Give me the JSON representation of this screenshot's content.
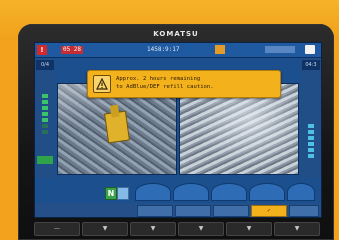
{
  "device": {
    "brand": "KOMATSU"
  },
  "statusbar": {
    "alert_label": "!",
    "mode_label": "05 28",
    "clock": "1458:9:17"
  },
  "left_panel": {
    "label": "0/4"
  },
  "right_panel": {
    "label": "04:3"
  },
  "warning": {
    "icon": "refill-warning-icon",
    "line1": "Approx. 2 hours remaining",
    "line2": "to AdBlue/DEF refill caution."
  },
  "drive": {
    "gear": "N"
  },
  "softkeys": [
    {
      "label": "",
      "active": false
    },
    {
      "label": "",
      "active": false
    },
    {
      "label": "",
      "active": false
    },
    {
      "label": "✓",
      "active": true
    },
    {
      "label": "",
      "active": false
    }
  ],
  "hard_buttons": [
    {
      "label": "—"
    },
    {
      "label": "▼"
    },
    {
      "label": "▼"
    },
    {
      "label": "▼"
    },
    {
      "label": "▼"
    },
    {
      "label": "▼"
    }
  ],
  "colors": {
    "frame_yellow": "#f2a21c",
    "screen_blue": "#1b4f8e",
    "warning_bg": "#f3b21b",
    "alert_red": "#d4282a",
    "gear_green": "#3aa34a"
  }
}
